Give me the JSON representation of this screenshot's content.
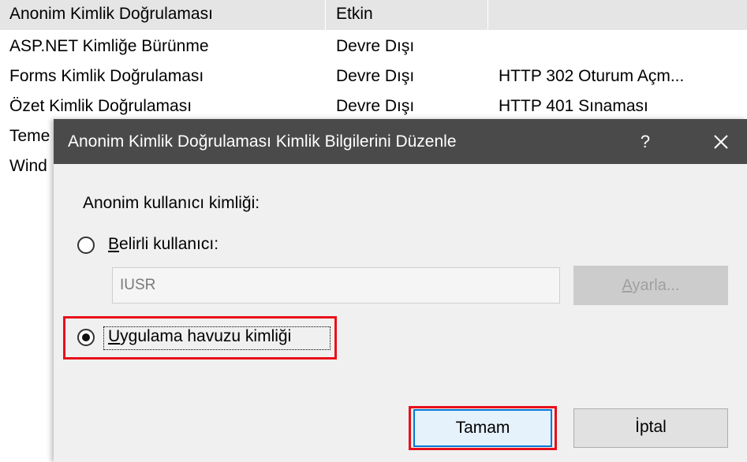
{
  "background_list": {
    "rows": [
      {
        "name": "Anonim Kimlik Doğrulaması",
        "status": "Etkin",
        "type": ""
      },
      {
        "name": "ASP.NET Kimliğe Bürünme",
        "status": "Devre Dışı",
        "type": ""
      },
      {
        "name": "Forms Kimlik Doğrulaması",
        "status": "Devre Dışı",
        "type": "HTTP 302 Oturum Açm..."
      },
      {
        "name": "Özet Kimlik Doğrulaması",
        "status": "Devre Dışı",
        "type": "HTTP 401 Sınaması"
      },
      {
        "name": "Teme",
        "status": "",
        "type": ""
      },
      {
        "name": "Wind",
        "status": "",
        "type": ""
      }
    ]
  },
  "dialog": {
    "title": "Anonim Kimlik Doğrulaması Kimlik Bilgilerini Düzenle",
    "help_label": "?",
    "identity_label": "Anonim kullanıcı kimliği:",
    "specific_user": {
      "label_mnemonic": "B",
      "label_rest": "elirli kullanıcı:",
      "selected": false,
      "value": "IUSR",
      "set_button_mnemonic": "A",
      "set_button_rest": "yarla..."
    },
    "app_pool": {
      "label_mnemonic": "U",
      "label_rest": "ygulama havuzu kimliği",
      "selected": true
    },
    "ok_label": "Tamam",
    "cancel_label": "İptal"
  },
  "colors": {
    "titlebar": "#4a4a4a",
    "highlight": "#e8101a",
    "dialog_bg": "#f0f0f0"
  }
}
